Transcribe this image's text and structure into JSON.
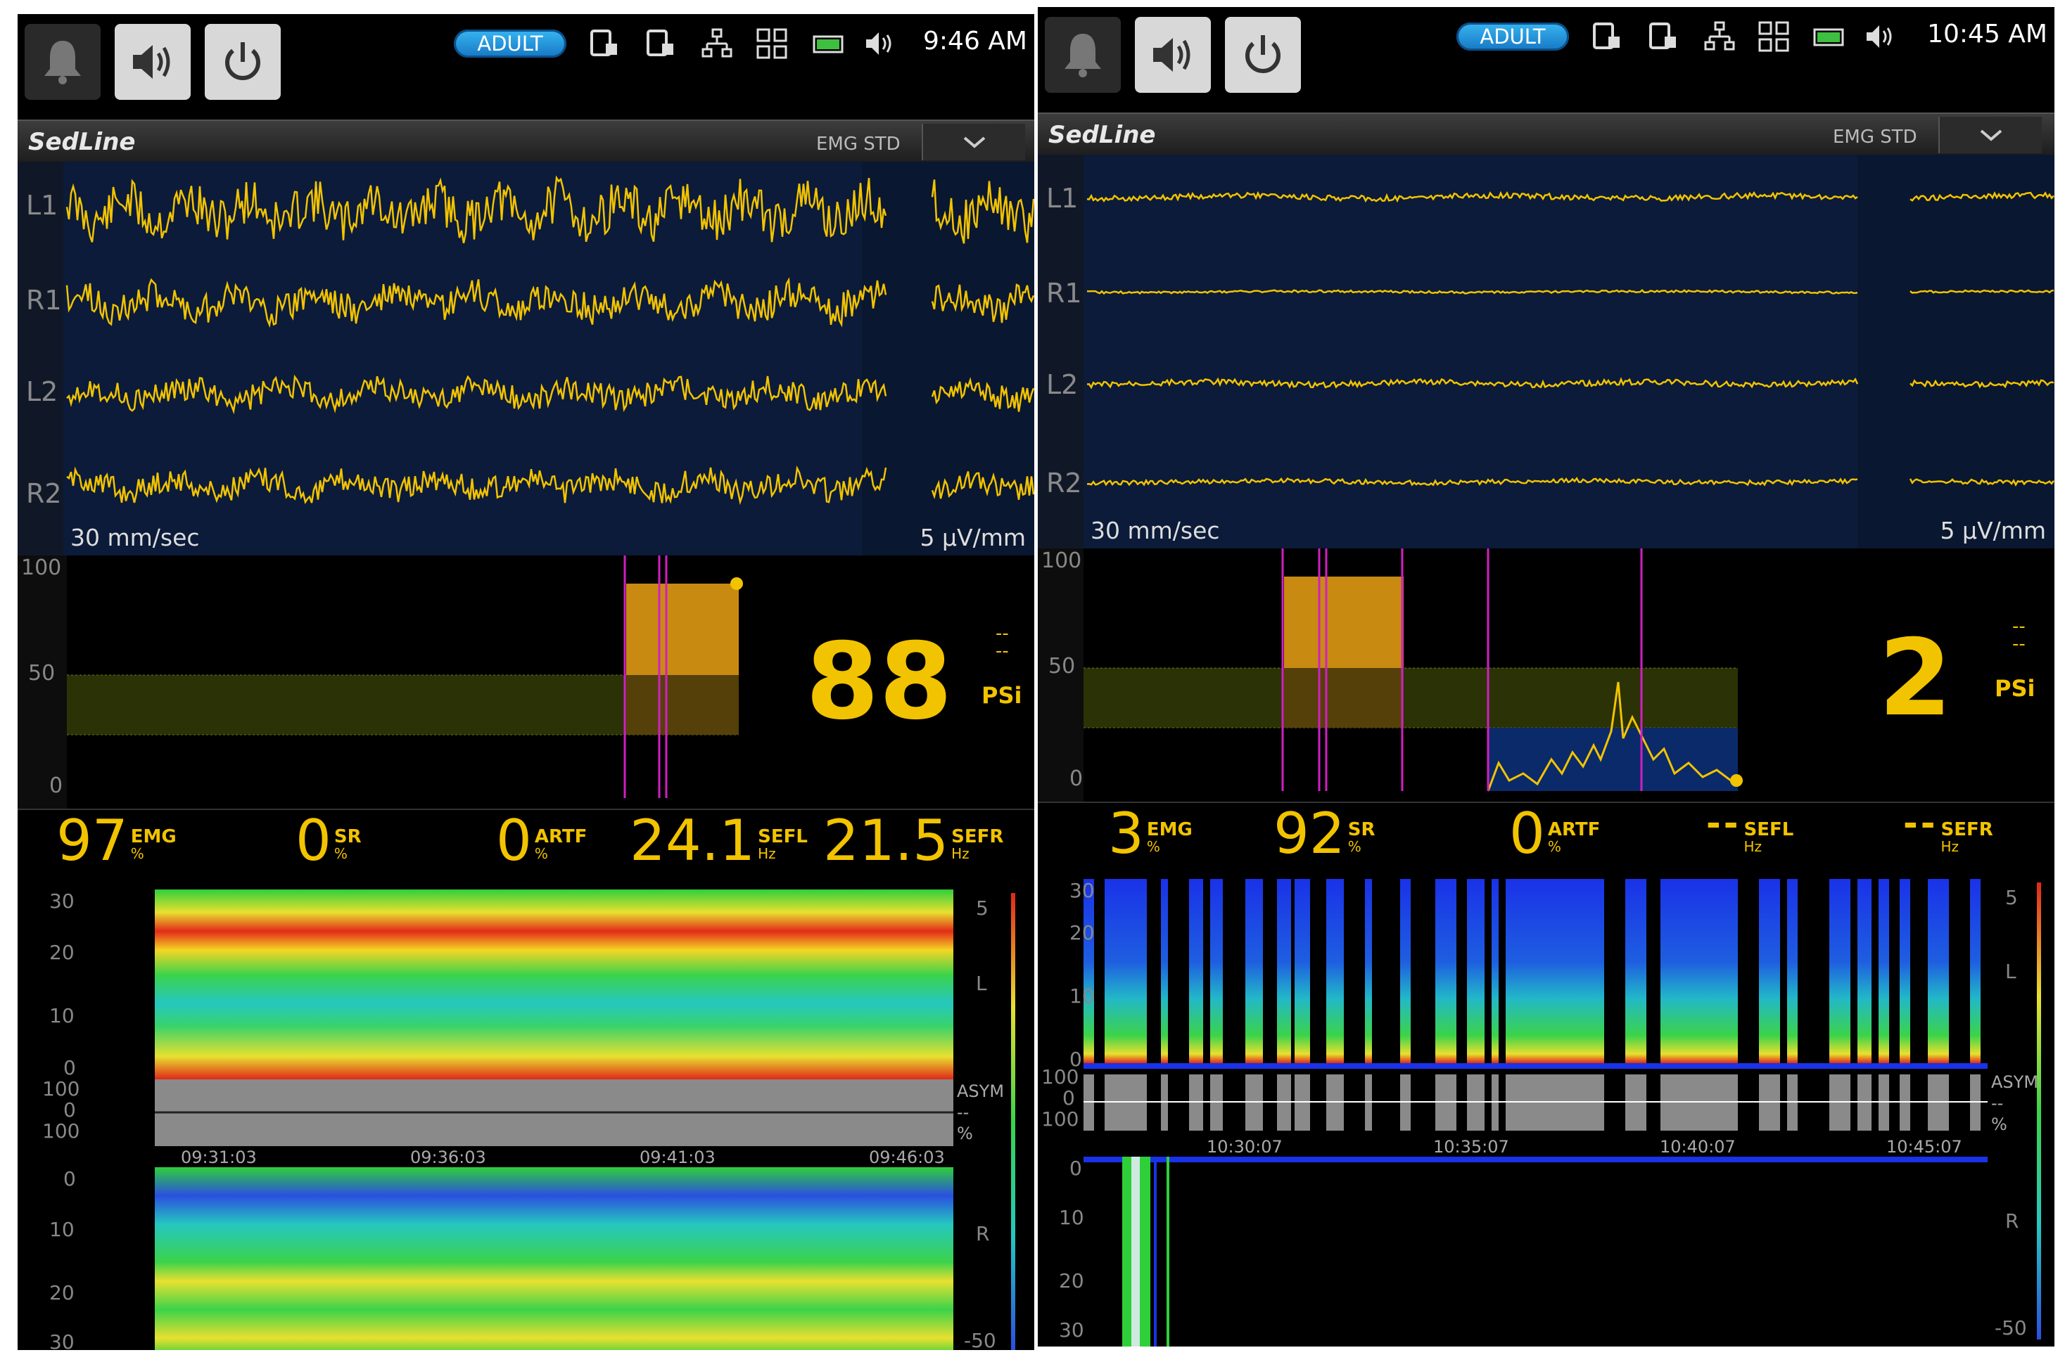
{
  "left": {
    "topbar": {
      "patient_mode": "ADULT",
      "clock": "9:46 AM"
    },
    "panel": {
      "title": "SedLine",
      "mode": "EMG STD"
    },
    "eeg": {
      "channels": [
        "L1",
        "R1",
        "L2",
        "R2"
      ],
      "speed": "30 mm/sec",
      "gain": "5 µV/mm"
    },
    "psi": {
      "axis": [
        "100",
        "50",
        "0"
      ],
      "value": "88",
      "label": "PSi",
      "dash": "--"
    },
    "params": [
      {
        "value": "97",
        "name": "EMG",
        "unit": "%"
      },
      {
        "value": "0",
        "name": "SR",
        "unit": "%"
      },
      {
        "value": "0",
        "name": "ARTF",
        "unit": "%"
      },
      {
        "value": "24.1",
        "name": "SEFL",
        "unit": "Hz"
      },
      {
        "value": "21.5",
        "name": "SEFR",
        "unit": "Hz"
      }
    ],
    "dsa": {
      "left_axis": [
        "30",
        "20",
        "10",
        "0"
      ],
      "asym_axis": [
        "100",
        "0",
        "100"
      ],
      "right_axis": [
        "0",
        "10",
        "20",
        "30"
      ],
      "times": [
        "09:31:03",
        "09:36:03",
        "09:41:03",
        "09:46:03"
      ],
      "scale_top": "5",
      "scale_bottom": "-50",
      "side_l": "L",
      "side_r": "R",
      "asym": "ASYM",
      "asym_dash": "--",
      "asym_unit": "%"
    }
  },
  "right": {
    "topbar": {
      "patient_mode": "ADULT",
      "clock": "10:45 AM"
    },
    "panel": {
      "title": "SedLine",
      "mode": "EMG STD"
    },
    "eeg": {
      "channels": [
        "L1",
        "R1",
        "L2",
        "R2"
      ],
      "speed": "30 mm/sec",
      "gain": "5 µV/mm"
    },
    "psi": {
      "axis": [
        "100",
        "50",
        "0"
      ],
      "value": "2",
      "label": "PSi",
      "dash": "--"
    },
    "params": [
      {
        "value": "3",
        "name": "EMG",
        "unit": "%"
      },
      {
        "value": "92",
        "name": "SR",
        "unit": "%"
      },
      {
        "value": "0",
        "name": "ARTF",
        "unit": "%"
      },
      {
        "value": "--",
        "name": "SEFL",
        "unit": "Hz"
      },
      {
        "value": "--",
        "name": "SEFR",
        "unit": "Hz"
      }
    ],
    "dsa": {
      "left_axis": [
        "30",
        "20",
        "10",
        "0"
      ],
      "asym_axis": [
        "100",
        "0",
        "100"
      ],
      "right_axis": [
        "0",
        "10",
        "20",
        "30"
      ],
      "times": [
        "10:30:07",
        "10:35:07",
        "10:40:07",
        "10:45:07"
      ],
      "scale_top": "5",
      "scale_bottom": "-50",
      "side_l": "L",
      "side_r": "R",
      "asym": "ASYM",
      "asym_dash": "--",
      "asym_unit": "%"
    }
  },
  "colors": {
    "trace": "#f2c300",
    "eeg_bg": "#0b1b39",
    "marker": "#d020c0",
    "badge": "#2196e0"
  },
  "icons": [
    "alarm-bell-icon",
    "audio-speaker-icon",
    "power-icon",
    "device-export-icon",
    "network-icon",
    "layout-grid-icon",
    "battery-icon",
    "volume-icon",
    "chevron-down-icon"
  ]
}
